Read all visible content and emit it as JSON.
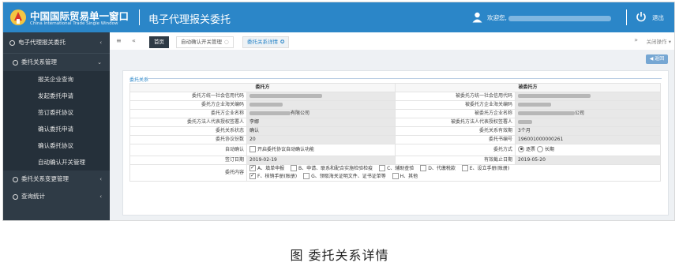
{
  "header": {
    "brand_cn": "中国国际贸易单一窗口",
    "brand_en": "China International Trade Single Window",
    "system_title": "电子代理报关委托",
    "welcome": "欢迎您,",
    "logout": "退出",
    "colors": {
      "header_bg": "#2b86c8",
      "sidebar_bg": "#2f3b46"
    }
  },
  "sidebar": {
    "main": "电子代理报关委托",
    "groups": [
      {
        "label": "委托关系管理",
        "items": [
          "报关企业查询",
          "发起委托申请",
          "签订委托协议",
          "确认委托申请",
          "确认委托协议",
          "自动确认开关管理"
        ]
      },
      {
        "label": "委托关系变更管理",
        "items": []
      },
      {
        "label": "查询统计",
        "items": []
      }
    ]
  },
  "tabs": {
    "home": "首页",
    "tab1": "自动确认开关管理",
    "tab2": "委托关系详情",
    "close_ops": "关闭操作"
  },
  "content": {
    "back_button": "返回",
    "legend": "委托关系",
    "head_left": "委托方",
    "head_right": "被委托方",
    "left_labels": {
      "credit_code": "委托方统一社会信用代码",
      "customs_code": "委托方企业海关编码",
      "company_name": "委托方企业名称",
      "legal_rep": "委托方法人代表授权签署人",
      "status_label": "委托关系状态",
      "copies_label": "委托协议份数",
      "auto_label": "自动确认",
      "sign_label": "签订日期",
      "content_label": "委托内容"
    },
    "right_labels": {
      "credit_code": "被委托方统一社会信用代码",
      "customs_code": "被委托方企业海关编码",
      "company_name": "被委托方企业名称",
      "legal_rep": "被委托方法人代表授权签署人",
      "validity_label": "委托关系有效期",
      "number_label": "委托书编号",
      "mode_label": "委托方式",
      "end_label": "有效截止日期"
    },
    "values": {
      "left_company_suffix": "有限公司",
      "left_legal_rep": "李娜",
      "status": "确认",
      "copies": "20",
      "auto_confirm_text": "开启委托协议自动确认功能",
      "sign_date": "2019-02-19",
      "right_company_suffix": "公司",
      "validity": "3个月",
      "number": "196001000000261",
      "mode_normal": "逐票",
      "mode_long": "长期",
      "end_date": "2019-05-20"
    },
    "content_options": [
      {
        "label": "A、填单申报",
        "checked": true
      },
      {
        "label": "B、申请、联系和配合实施检验检疫",
        "checked": false
      },
      {
        "label": "C、辅助查验",
        "checked": false
      },
      {
        "label": "D、代缴税款",
        "checked": false
      },
      {
        "label": "E、设立手册(账册)",
        "checked": false
      },
      {
        "label": "F、核销手册(账册)",
        "checked": true
      },
      {
        "label": "G、领取海关证明文件、证书证单等",
        "checked": false
      },
      {
        "label": "H、其他",
        "checked": false
      }
    ]
  },
  "caption": "图 委托关系详情"
}
